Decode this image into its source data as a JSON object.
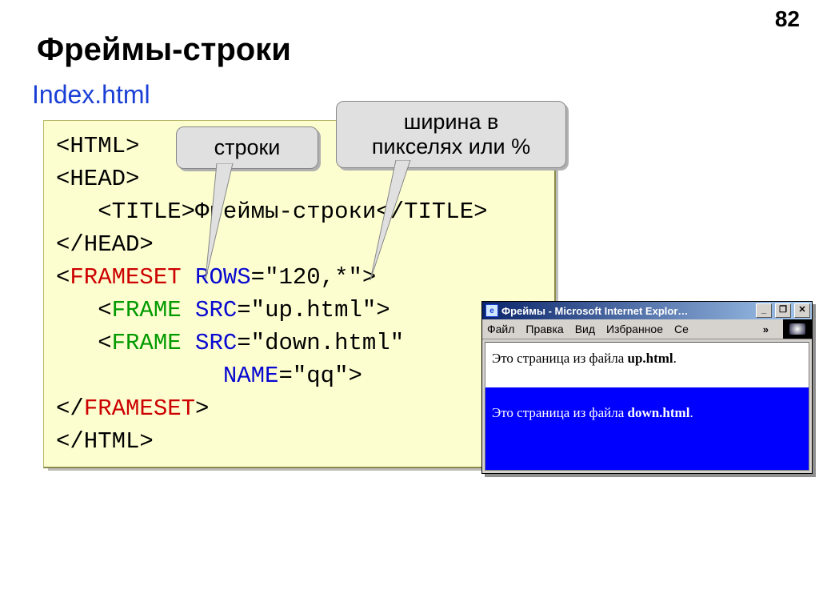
{
  "page_number": "82",
  "heading": "Фреймы-строки",
  "subhead": "Index.html",
  "callout1": "строки",
  "callout2_line1": "ширина в",
  "callout2_line2": "пикселях или %",
  "code": {
    "line1_open": "<HTML>",
    "line2_open": "<HEAD>",
    "line3_title_open": "<TITLE>",
    "line3_title_text": "Фреймы-строки",
    "line3_title_close": "</TITLE>",
    "line4_close": "</HEAD>",
    "line5_tag_open": "<",
    "line5_tag_name": "FRAMESET",
    "line5_sp": " ",
    "line5_attr": "ROWS",
    "line5_eq": "=\"120,*\">",
    "line6_tag_open": "<",
    "line6_tag_name": "FRAME",
    "line6_sp": " ",
    "line6_attr": "SRC",
    "line6_eq": "=\"up.html\">",
    "line7_tag_open": "<",
    "line7_tag_name": "FRAME",
    "line7_sp": " ",
    "line7_attr": "SRC",
    "line7_eq": "=\"down.html\"",
    "line8_indent": "            ",
    "line8_attr": "NAME",
    "line8_eq": "=\"qq\">",
    "line9_tag_open": "</",
    "line9_tag_name": "FRAMESET",
    "line9_tag_close": ">",
    "line10_close": "</HTML>"
  },
  "browser": {
    "title": "Фреймы - Microsoft Internet Explor…",
    "ie_letter": "e",
    "btn_min": "_",
    "btn_max": "❐",
    "btn_close": "✕",
    "menu": {
      "file": "Файл",
      "edit": "Правка",
      "view": "Вид",
      "fav": "Избранное",
      "serv": "Се",
      "chev": "»"
    },
    "top_text_pre": "Это страница из файла ",
    "top_text_bold": "up.html",
    "top_text_post": ".",
    "bottom_text_pre": "Это страница из файла ",
    "bottom_text_bold": "down.html",
    "bottom_text_post": "."
  }
}
